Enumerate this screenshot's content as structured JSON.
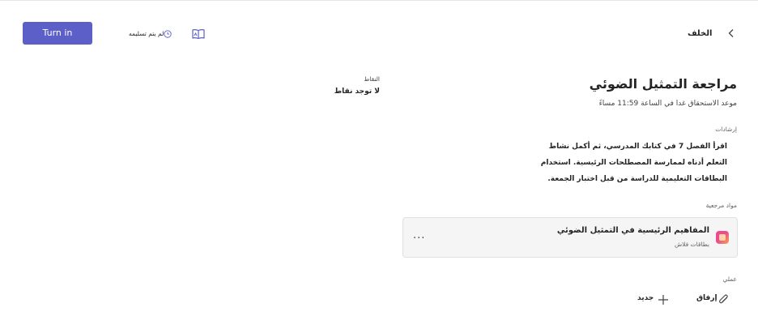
{
  "toolbar": {
    "turn_in_label": "Turn in",
    "status_text": "لم يتم تسليمه",
    "back_label": "الخلف"
  },
  "points": {
    "title": "النقاط",
    "value": "لا توجد نقاط"
  },
  "assignment": {
    "title": "مراجعة التمثيل الضوئي",
    "due": "موعد الاستحقاق غدا في الساعة 11:59 مساءً"
  },
  "instructions": {
    "title": "إرشادات",
    "body": "اقرأ الفصل 7 في كتابك المدرسي، ثم أكمل نشاط التعلم أدناه لممارسة المصطلحات الرئيسية. استخدام البطاقات التعليمية للدراسة من قبل اختبار الجمعة."
  },
  "references": {
    "title": "مواد مرجعية",
    "items": [
      {
        "name": "المفاهيم الرئيسية في التمثيل الضوئي",
        "type": "بطاقات فلاش",
        "more": "..."
      }
    ]
  },
  "work": {
    "title": "عملي",
    "attach_label": "إرفاق",
    "new_label": "جديد"
  },
  "icons": {
    "reader": "immersive-reader-icon",
    "clock": "clock-icon",
    "back": "chevron-left-icon",
    "attach": "paperclip-icon",
    "new": "plus-icon",
    "flashcard": "flashcards-app-icon"
  },
  "colors": {
    "accent": "#5b5fc7",
    "card_bg": "#f5f5f5"
  }
}
